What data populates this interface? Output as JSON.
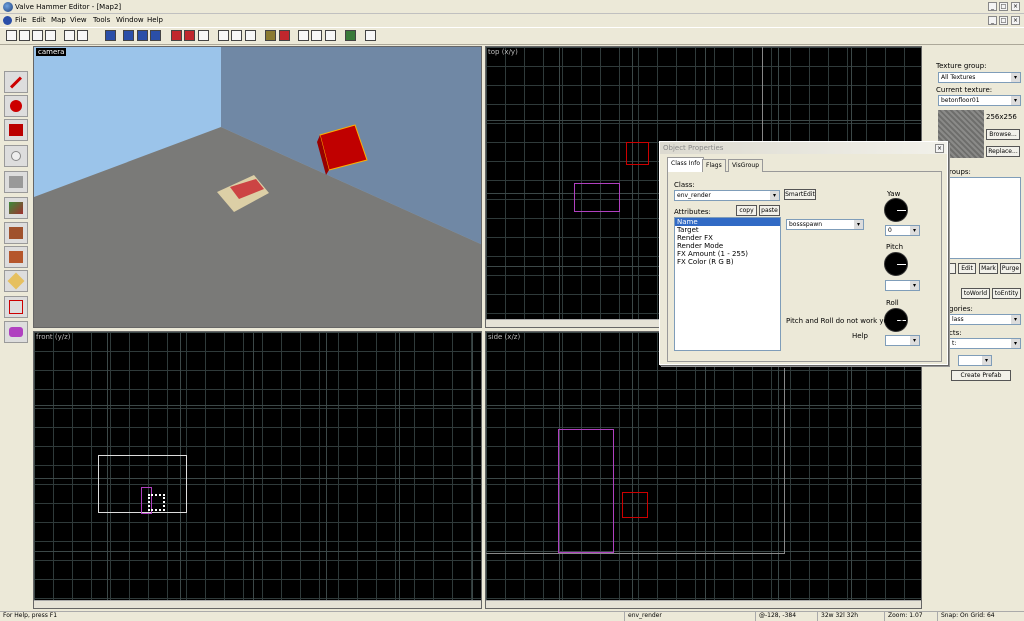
{
  "window": {
    "title": "Valve Hammer Editor - [Map2]"
  },
  "menu": [
    "File",
    "Edit",
    "Map",
    "View",
    "Tools",
    "Window",
    "Help"
  ],
  "viewports": {
    "camera": "camera",
    "top": "top (x/y)",
    "front": "front (y/z)",
    "side": "side (x/z)"
  },
  "texture_panel": {
    "group_label": "Texture group:",
    "group_value": "All Textures",
    "current_label": "Current texture:",
    "current_value": "betonfloor01",
    "size": "256x256",
    "browse": "Browse...",
    "replace": "Replace..."
  },
  "groups_panel": {
    "groups_label": "roups:",
    "edit": "Edit",
    "mark": "Mark",
    "purge": "Purge",
    "to_world": "toWorld",
    "to_entity": "toEntity",
    "categories_label": "gories:",
    "categories_value": "lass",
    "objects_label": "cts:",
    "objects_value": "t:",
    "create_prefab": "Create Prefab"
  },
  "dialog": {
    "title": "Object Properties",
    "tabs": [
      "Class Info",
      "Flags",
      "VisGroup"
    ],
    "class_label": "Class:",
    "class_value": "env_render",
    "smartedit": "SmartEdit",
    "attributes_label": "Attributes:",
    "copy": "copy",
    "paste": "paste",
    "attributes": [
      "Name",
      "Target",
      "Render FX",
      "Render Mode",
      "FX Amount (1 - 255)",
      "FX Color (R G B)"
    ],
    "value": "bossspawn",
    "yaw_label": "Yaw",
    "yaw_value": "0",
    "pitch_label": "Pitch",
    "roll_label": "Roll",
    "note": "Pitch and Roll do not work yet. ->",
    "help": "Help"
  },
  "status": {
    "help": "For Help, press F1",
    "object": "env_render",
    "coords": "@-128, -384",
    "size": "32w 32l 32h",
    "zoom": "Zoom: 1.07",
    "snap": "Snap: On Grid: 64"
  }
}
